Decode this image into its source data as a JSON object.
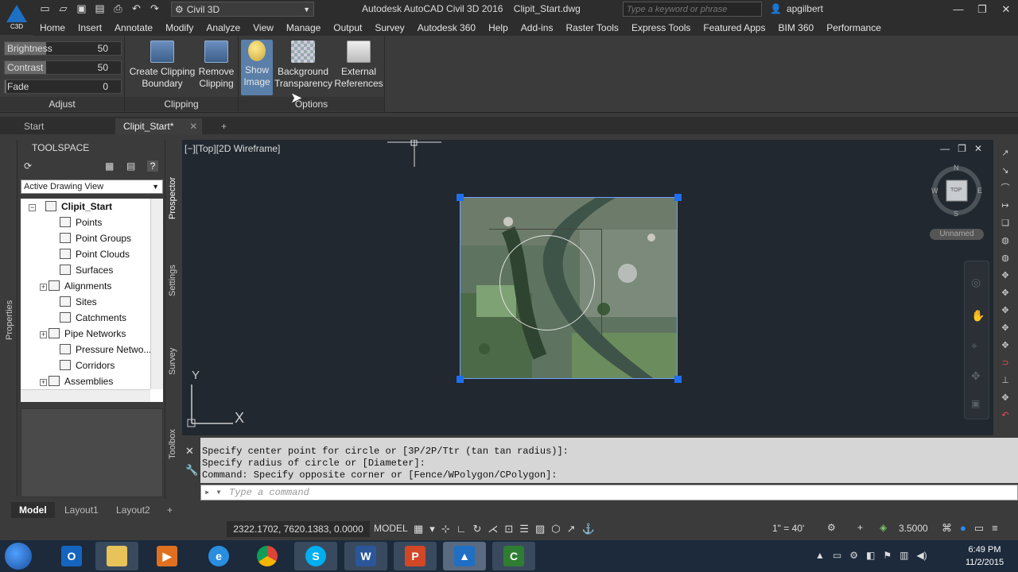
{
  "app": {
    "logo_label": "C3D",
    "workspace": "Civil 3D",
    "title": "Autodesk AutoCAD Civil 3D 2016",
    "filename": "Clipit_Start.dwg",
    "search_placeholder": "Type a keyword or phrase",
    "username": "apgilbert"
  },
  "menu_tabs": [
    "Home",
    "Insert",
    "Annotate",
    "Modify",
    "Analyze",
    "View",
    "Manage",
    "Output",
    "Survey",
    "Autodesk 360",
    "Help",
    "Add-ins",
    "Raster Tools",
    "Express Tools",
    "Featured Apps",
    "BIM 360",
    "Performance"
  ],
  "ribbon": {
    "adjust": {
      "title": "Adjust",
      "brightness_label": "Brightness",
      "brightness_value": "50",
      "contrast_label": "Contrast",
      "contrast_value": "50",
      "fade_label": "Fade",
      "fade_value": "0"
    },
    "clipping": {
      "title": "Clipping",
      "create_line1": "Create Clipping",
      "create_line2": "Boundary",
      "remove_line1": "Remove",
      "remove_line2": "Clipping"
    },
    "options": {
      "title": "Options",
      "show_line1": "Show",
      "show_line2": "Image",
      "bg_line1": "Background",
      "bg_line2": "Transparency",
      "ext_line1": "External",
      "ext_line2": "References"
    }
  },
  "file_tabs": {
    "start": "Start",
    "active": "Clipit_Start*",
    "add": "+"
  },
  "toolspace": {
    "title": "TOOLSPACE",
    "view_select": "Active Drawing View",
    "root": "Clipit_Start",
    "items": [
      {
        "label": "Points",
        "expandable": false
      },
      {
        "label": "Point Groups",
        "expandable": false
      },
      {
        "label": "Point Clouds",
        "expandable": false
      },
      {
        "label": "Surfaces",
        "expandable": false
      },
      {
        "label": "Alignments",
        "expandable": true
      },
      {
        "label": "Sites",
        "expandable": false
      },
      {
        "label": "Catchments",
        "expandable": false
      },
      {
        "label": "Pipe Networks",
        "expandable": true
      },
      {
        "label": "Pressure Netwo...",
        "expandable": false
      },
      {
        "label": "Corridors",
        "expandable": false
      },
      {
        "label": "Assemblies",
        "expandable": true
      }
    ],
    "vtabs": [
      "Prospector",
      "Settings",
      "Survey",
      "Toolbox"
    ],
    "properties": "Properties"
  },
  "viewport": {
    "label": "[−][Top][2D Wireframe]",
    "viewcube_top": "TOP",
    "compass_n": "N",
    "compass_s": "S",
    "compass_e": "E",
    "compass_w": "W",
    "ucs_name": "Unnamed",
    "ucs_x": "X",
    "ucs_y": "Y"
  },
  "command": {
    "history": [
      "Specify center point for circle or [3P/2P/Ttr (tan tan radius)]:",
      "Specify radius of circle or [Diameter]:",
      "Command: Specify opposite corner or [Fence/WPolygon/CPolygon]:"
    ],
    "placeholder": "Type a command"
  },
  "layout_tabs": [
    "Model",
    "Layout1",
    "Layout2"
  ],
  "status": {
    "coords": "2322.1702, 7620.1383, 0.0000",
    "model": "MODEL",
    "scale": "1\" = 40'",
    "lineweight": "3.5000"
  },
  "clock": {
    "time": "6:49 PM",
    "date": "11/2/2015"
  },
  "colors": {
    "grip": "#1e6ef0",
    "drawing_bg": "#212830",
    "active_button": "#5a7fa8"
  }
}
